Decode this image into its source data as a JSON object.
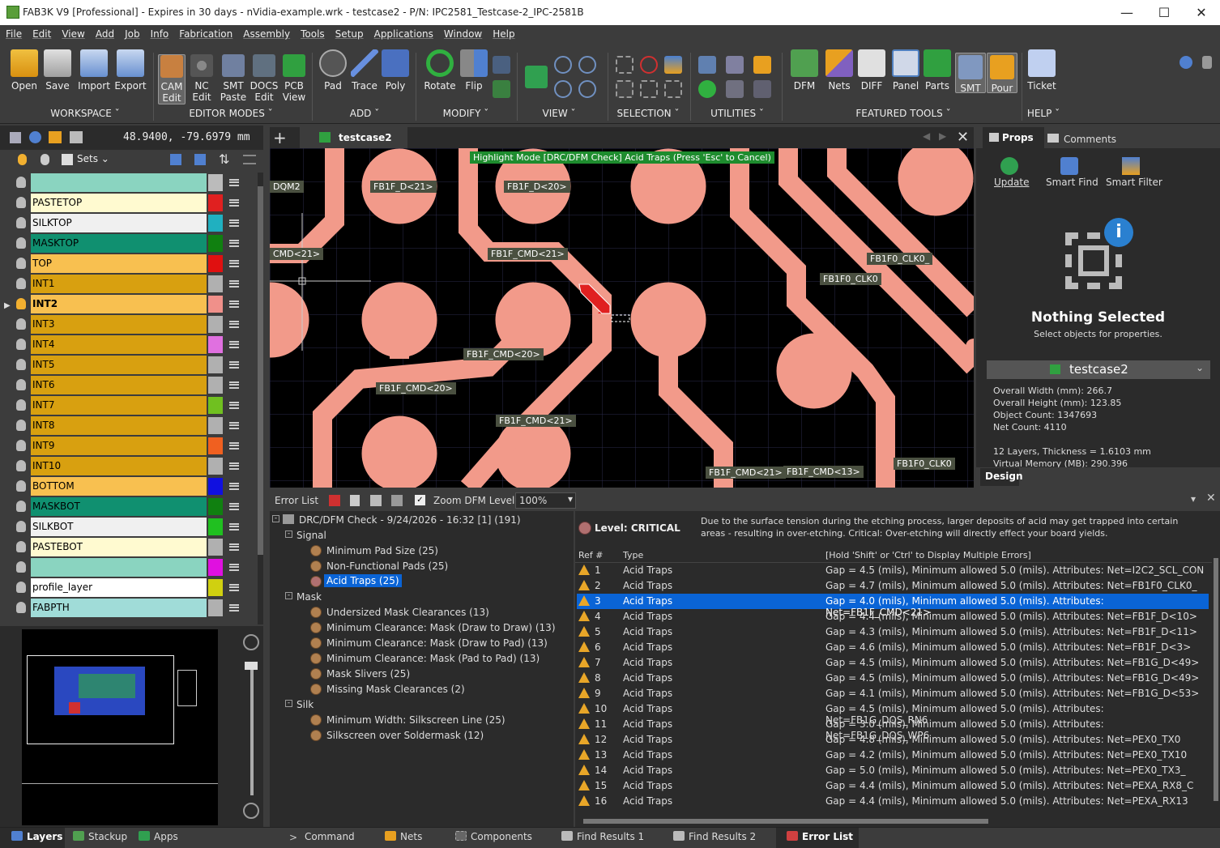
{
  "titlebar": {
    "title": "FAB3K V9 [Professional] - Expires in 30 days -   nVidia-example.wrk - testcase2 - P/N: IPC2581_Testcase-2_IPC-2581B"
  },
  "menu": [
    "File",
    "Edit",
    "View",
    "Add",
    "Job",
    "Info",
    "Fabrication",
    "Assembly",
    "Tools",
    "Setup",
    "Applications",
    "Window",
    "Help"
  ],
  "ribbon": {
    "workspace": {
      "label": "WORKSPACE",
      "buttons": [
        "Open",
        "Save",
        "Import",
        "Export"
      ]
    },
    "editor": {
      "label": "EDITOR MODES",
      "buttons": [
        "CAM\nEdit",
        "NC\nEdit",
        "SMT\nPaste",
        "DOCS\nEdit",
        "PCB\nView"
      ]
    },
    "add": {
      "label": "ADD",
      "buttons": [
        "Pad",
        "Trace",
        "Poly"
      ]
    },
    "modify": {
      "label": "MODIFY",
      "buttons": [
        "Rotate",
        "Flip"
      ]
    },
    "view": {
      "label": "VIEW"
    },
    "selection": {
      "label": "SELECTION"
    },
    "utilities": {
      "label": "UTILITIES"
    },
    "featured": {
      "label": "FEATURED TOOLS",
      "buttons": [
        "DFM",
        "Nets",
        "DIFF",
        "Panel",
        "Parts",
        "SMT",
        "Pour"
      ]
    },
    "help": {
      "label": "HELP",
      "buttons": [
        "Ticket"
      ]
    }
  },
  "coords": "48.9400, -79.6979    mm",
  "layer_toolbar": {
    "sets": "Sets"
  },
  "layers": [
    {
      "name": "",
      "bg": "#8ad4c0",
      "color": "#bbbbbb",
      "bulb": false,
      "graphic": true
    },
    {
      "name": "PASTETOP",
      "bg": "#fffad0",
      "color": "#e02020",
      "bulb": false
    },
    {
      "name": "SILKTOP",
      "bg": "#f0f0f0",
      "color": "#20b0c0",
      "bulb": false
    },
    {
      "name": "MASKTOP",
      "bg": "#109070",
      "color": "#108010",
      "bulb": false
    },
    {
      "name": "TOP",
      "bg": "#f8c050",
      "color": "#e01010",
      "bulb": false
    },
    {
      "name": "INT1",
      "bg": "#d8a010",
      "color": "#b0b0b0",
      "bulb": false
    },
    {
      "name": "INT2",
      "bg": "#f8c050",
      "color": "#f0908a",
      "bulb": true,
      "bold": true
    },
    {
      "name": "INT3",
      "bg": "#d8a010",
      "color": "#b0b0b0",
      "bulb": false
    },
    {
      "name": "INT4",
      "bg": "#d8a010",
      "color": "#e070e0",
      "bulb": false
    },
    {
      "name": "INT5",
      "bg": "#d8a010",
      "color": "#b0b0b0",
      "bulb": false
    },
    {
      "name": "INT6",
      "bg": "#d8a010",
      "color": "#b0b0b0",
      "bulb": false
    },
    {
      "name": "INT7",
      "bg": "#d8a010",
      "color": "#70c020",
      "bulb": false
    },
    {
      "name": "INT8",
      "bg": "#d8a010",
      "color": "#b0b0b0",
      "bulb": false
    },
    {
      "name": "INT9",
      "bg": "#d8a010",
      "color": "#f06020",
      "bulb": false
    },
    {
      "name": "INT10",
      "bg": "#d8a010",
      "color": "#b0b0b0",
      "bulb": false
    },
    {
      "name": "BOTTOM",
      "bg": "#f8c050",
      "color": "#1010e0",
      "bulb": false
    },
    {
      "name": "MASKBOT",
      "bg": "#109070",
      "color": "#108010",
      "bulb": false
    },
    {
      "name": "SILKBOT",
      "bg": "#f0f0f0",
      "color": "#20c020",
      "bulb": false
    },
    {
      "name": "PASTEBOT",
      "bg": "#fffad0",
      "color": "#b0b0b0",
      "bulb": false
    },
    {
      "name": "",
      "bg": "#8ad4c0",
      "color": "#e010e0",
      "bulb": false,
      "graphic": true
    },
    {
      "name": "profile_layer",
      "bg": "#ffffff",
      "color": "#d0d010",
      "bulb": false
    },
    {
      "name": "FABPTH",
      "bg": "#a0dcd8",
      "color": "#b0b0b0",
      "bulb": false
    }
  ],
  "canvas": {
    "tab": "testcase2",
    "banner": "Highlight Mode [DRC/DFM Check]  Acid Traps     (Press 'Esc' to Cancel)",
    "labels": [
      "DQM2",
      "FB1F_D<21>",
      "FB1F_D<20>",
      "CMD<21>",
      "FB1F_CMD<21>",
      "FB1F0_CLK0_",
      "FB1F0_CLK0",
      "FB1F_CMD<20>",
      "FB1F_CMD<20>",
      "FB1F_CMD<21>",
      "FB1F_CMD<21>",
      "FB1F_CMD<13>",
      "FB1F0_CLK0"
    ]
  },
  "props": {
    "tab1": "Props",
    "tab2": "Comments",
    "buttons": [
      "Update",
      "Smart Find",
      "Smart Filter"
    ],
    "nothing": "Nothing Selected",
    "hint": "Select objects for properties.",
    "design": "testcase2",
    "info": [
      "Overall Width (mm): 266.7",
      "Overall Height (mm): 123.85",
      "Object Count: 1347693",
      "Net Count: 4110",
      "",
      "12 Layers, Thickness = 1.6103 mm",
      "Virtual Memory (MB): 290.396"
    ],
    "design_tab": "Design"
  },
  "errorlist": {
    "title": "Error List",
    "zoom_label": "Zoom DFM Level",
    "zoom_value": "100%",
    "root": "DRC/DFM Check - 9/24/2026 - 16:32 [1] (191)",
    "groups": [
      {
        "name": "Signal",
        "items": [
          "Minimum Pad Size (25)",
          "Non-Functional Pads (25)",
          "Acid Traps (25)"
        ]
      },
      {
        "name": "Mask",
        "items": [
          "Undersized Mask Clearances (13)",
          "Minimum Clearance: Mask (Draw to Draw) (13)",
          "Minimum Clearance: Mask (Draw to Pad) (13)",
          "Minimum Clearance: Mask (Pad to Pad) (13)",
          "Mask Slivers (25)",
          "Missing Mask Clearances (2)"
        ]
      },
      {
        "name": "Silk",
        "items": [
          "Minimum Width: Silkscreen Line (25)",
          "Silkscreen over Soldermask (12)"
        ]
      }
    ],
    "level": "Level: CRITICAL",
    "desc": "Due to the surface tension during the etching process, larger deposits of acid may get trapped into certain areas - resulting in over-etching. Critical:  Over-etching will directly effect your board yields.",
    "cols": [
      "Ref #",
      "Type",
      "[Hold 'Shift' or 'Ctrl' to Display Multiple Errors]"
    ],
    "rows": [
      [
        "1",
        "Acid Traps",
        "Gap = 4.5 (mils), Minimum allowed 5.0 (mils).  Attributes: Net=I2C2_SCL_CON"
      ],
      [
        "2",
        "Acid Traps",
        "Gap = 4.7 (mils), Minimum allowed 5.0 (mils).  Attributes: Net=FB1F0_CLK0_"
      ],
      [
        "3",
        "Acid Traps",
        "Gap = 4.0 (mils), Minimum allowed 5.0 (mils).  Attributes: Net=FB1F_CMD<21>"
      ],
      [
        "4",
        "Acid Traps",
        "Gap = 4.4 (mils), Minimum allowed 5.0 (mils).  Attributes: Net=FB1F_D<10>"
      ],
      [
        "5",
        "Acid Traps",
        "Gap = 4.3 (mils), Minimum allowed 5.0 (mils).  Attributes: Net=FB1F_D<11>"
      ],
      [
        "6",
        "Acid Traps",
        "Gap = 4.6 (mils), Minimum allowed 5.0 (mils).  Attributes: Net=FB1F_D<3>"
      ],
      [
        "7",
        "Acid Traps",
        "Gap = 4.5 (mils), Minimum allowed 5.0 (mils).  Attributes: Net=FB1G_D<49>"
      ],
      [
        "8",
        "Acid Traps",
        "Gap = 4.5 (mils), Minimum allowed 5.0 (mils).  Attributes: Net=FB1G_D<49>"
      ],
      [
        "9",
        "Acid Traps",
        "Gap = 4.1 (mils), Minimum allowed 5.0 (mils).  Attributes: Net=FB1G_D<53>"
      ],
      [
        "10",
        "Acid Traps",
        "Gap = 4.5 (mils), Minimum allowed 5.0 (mils).  Attributes: Net=FB1G_DQS_RN6"
      ],
      [
        "11",
        "Acid Traps",
        "Gap = 3.0 (mils), Minimum allowed 5.0 (mils).  Attributes: Net=FB1G_DQS_WP6"
      ],
      [
        "12",
        "Acid Traps",
        "Gap = 4.8 (mils), Minimum allowed 5.0 (mils).  Attributes: Net=PEX0_TX0"
      ],
      [
        "13",
        "Acid Traps",
        "Gap = 4.2 (mils), Minimum allowed 5.0 (mils).  Attributes: Net=PEX0_TX10"
      ],
      [
        "14",
        "Acid Traps",
        "Gap = 5.0 (mils), Minimum allowed 5.0 (mils).  Attributes: Net=PEX0_TX3_"
      ],
      [
        "15",
        "Acid Traps",
        "Gap = 4.4 (mils), Minimum allowed 5.0 (mils).  Attributes: Net=PEXA_RX8_C"
      ],
      [
        "16",
        "Acid Traps",
        "Gap = 4.4 (mils), Minimum allowed 5.0 (mils).  Attributes: Net=PEXA_RX13"
      ]
    ]
  },
  "bottom_tabs": [
    "Layers",
    "Stackup",
    "Apps",
    "Command",
    "Nets",
    "Components",
    "Find Results 1",
    "Find Results 2",
    "Error List"
  ]
}
